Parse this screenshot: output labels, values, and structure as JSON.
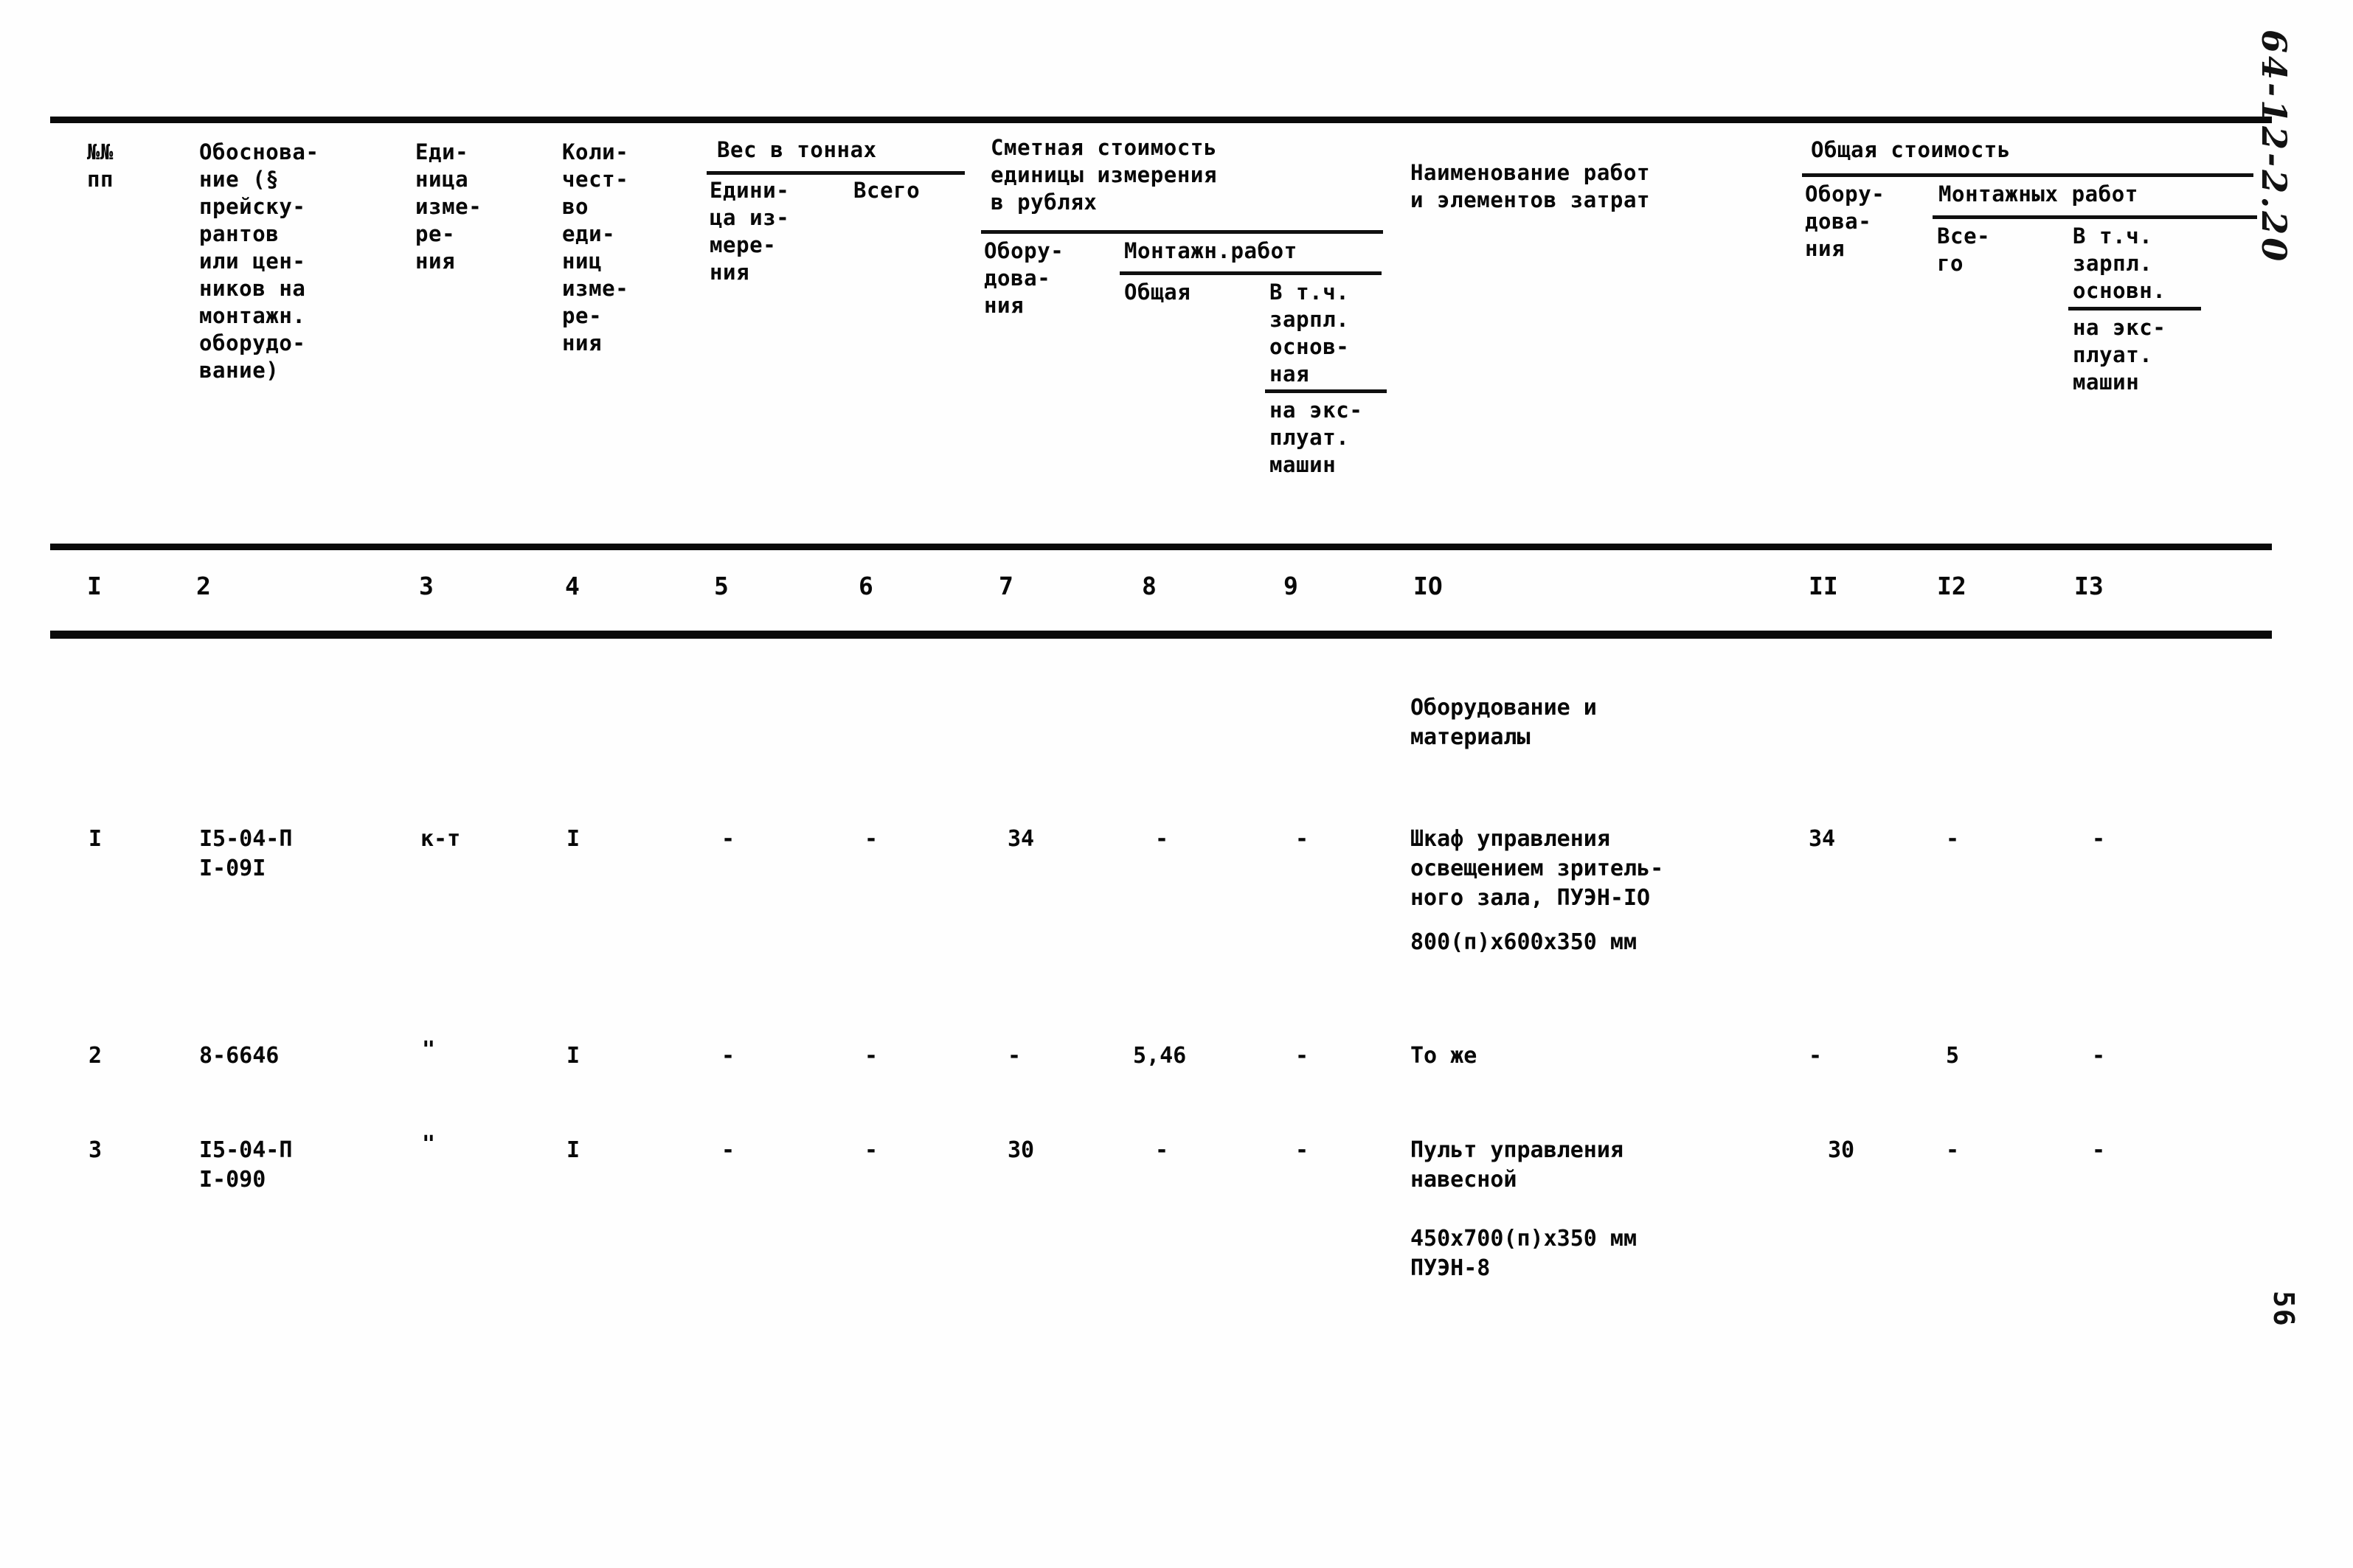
{
  "document": {
    "type": "soviet-construction-estimate-table",
    "page_number": "56",
    "margin_note": "64-12-2.20"
  },
  "header": {
    "col1_no_pp": "№№\nпп",
    "col2_basis": "Обоснова-\nние (§\nпрейску-\nрантов\nили цен-\nников на\nмонтажн.\nоборудо-\nвание)",
    "col3_unit": "Еди-\nница\nизме-\nре-\nния",
    "col4_qty": "Коли-\nчест-\nво\nеди-\nниц\nизме-\nре-\nния",
    "weight_group": "Вес в тоннах",
    "col5_weight_unit": "Едини-\nца из-\nмере-\nния",
    "col6_weight_total": "Всего",
    "cost_group": "Сметная стоимость\nединицы измерения\nв рублях",
    "col7_equipment": "Обору-\nдова-\nния",
    "montazh_group": "Монтажн.работ",
    "col8_total": "Общая",
    "col9_incl_wages": "В т.ч.\nзарпл.\nоснов-\nная",
    "col9_machines": "на экс-\nплуат.\nмашин",
    "col10_name": "Наименование работ\nи элементов затрат",
    "total_group": "Общая стоимость",
    "col11_equipment": "Обору-\nдова-\nния",
    "col12_13_group": "Монтажных работ",
    "col12_total": "Все-\nго",
    "col13_incl_wages": "В т.ч.\nзарпл.\nосновн.",
    "col13_machines": "на экс-\nплуат.\nмашин"
  },
  "column_numbers": [
    "I",
    "2",
    "3",
    "4",
    "5",
    "6",
    "7",
    "8",
    "9",
    "IO",
    "II",
    "I2",
    "I3"
  ],
  "section_title": "Оборудование и\nматериалы",
  "rows": [
    {
      "no": "I",
      "basis": "I5-04-П\nI-09I",
      "unit": "к-т",
      "qty": "I",
      "weight_unit": "-",
      "weight_total": "-",
      "cost_equipment": "34",
      "cost_montazh_total": "-",
      "cost_incl_wages": "-",
      "name": "Шкаф управления\nосвещением зритель-\nного зала, ПУЭН-IO",
      "name_extra": "800(п)х600х350 мм",
      "total_equipment": "34",
      "total_montazh": "-",
      "total_incl_wages": "-"
    },
    {
      "no": "2",
      "basis": "8-6646",
      "unit": "\"",
      "qty": "I",
      "weight_unit": "-",
      "weight_total": "-",
      "cost_equipment": "-",
      "cost_montazh_total": "5,46",
      "cost_incl_wages": "-",
      "name": "То же",
      "name_extra": "",
      "total_equipment": "-",
      "total_montazh": "5",
      "total_incl_wages": "-"
    },
    {
      "no": "3",
      "basis": "I5-04-П\nI-090",
      "unit": "\"",
      "qty": "I",
      "weight_unit": "-",
      "weight_total": "-",
      "cost_equipment": "30",
      "cost_montazh_total": "-",
      "cost_incl_wages": "-",
      "name": "Пульт управления\nнавесной",
      "name_extra": "450х700(п)х350 мм\nПУЭН-8",
      "total_equipment": "30",
      "total_montazh": "-",
      "total_incl_wages": "-"
    }
  ]
}
